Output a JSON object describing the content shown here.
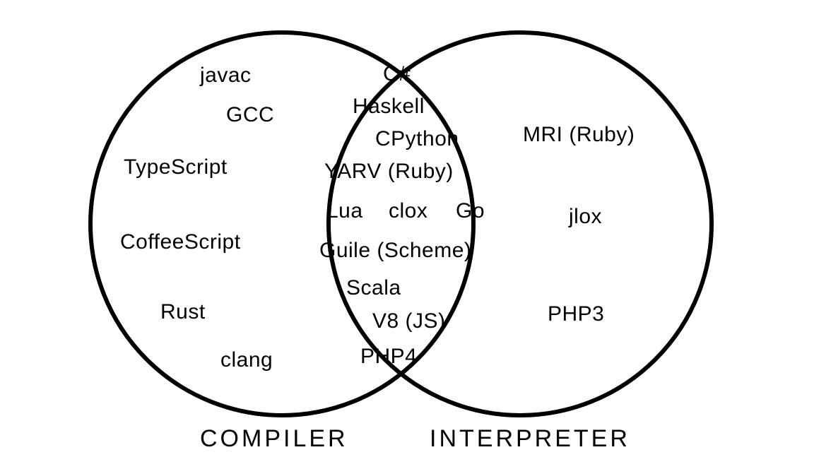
{
  "diagram": {
    "left_label": "COMPILER",
    "right_label": "INTERPRETER",
    "left_only": {
      "javac": "javac",
      "gcc": "GCC",
      "typescript": "TypeScript",
      "coffeescript": "CoffeeScript",
      "rust": "Rust",
      "clang": "clang"
    },
    "intersection": {
      "csharp": "C#",
      "haskell": "Haskell",
      "cpython": "CPython",
      "yarv": "YARV (Ruby)",
      "lua": "Lua",
      "clox": "clox",
      "go": "Go",
      "guile": "Guile (Scheme)",
      "scala": "Scala",
      "v8": "V8 (JS)",
      "php4": "PHP4"
    },
    "right_only": {
      "mri": "MRI (Ruby)",
      "jlox": "jlox",
      "php3": "PHP3"
    }
  },
  "chart_data": {
    "type": "venn",
    "sets": [
      {
        "name": "COMPILER",
        "items": [
          "javac",
          "GCC",
          "TypeScript",
          "CoffeeScript",
          "Rust",
          "clang"
        ]
      },
      {
        "name": "INTERPRETER",
        "items": [
          "MRI (Ruby)",
          "jlox",
          "PHP3"
        ]
      }
    ],
    "intersections": [
      {
        "sets": [
          "COMPILER",
          "INTERPRETER"
        ],
        "items": [
          "C#",
          "Haskell",
          "CPython",
          "YARV (Ruby)",
          "Lua",
          "clox",
          "Go",
          "Guile (Scheme)",
          "Scala",
          "V8 (JS)",
          "PHP4"
        ]
      }
    ]
  }
}
